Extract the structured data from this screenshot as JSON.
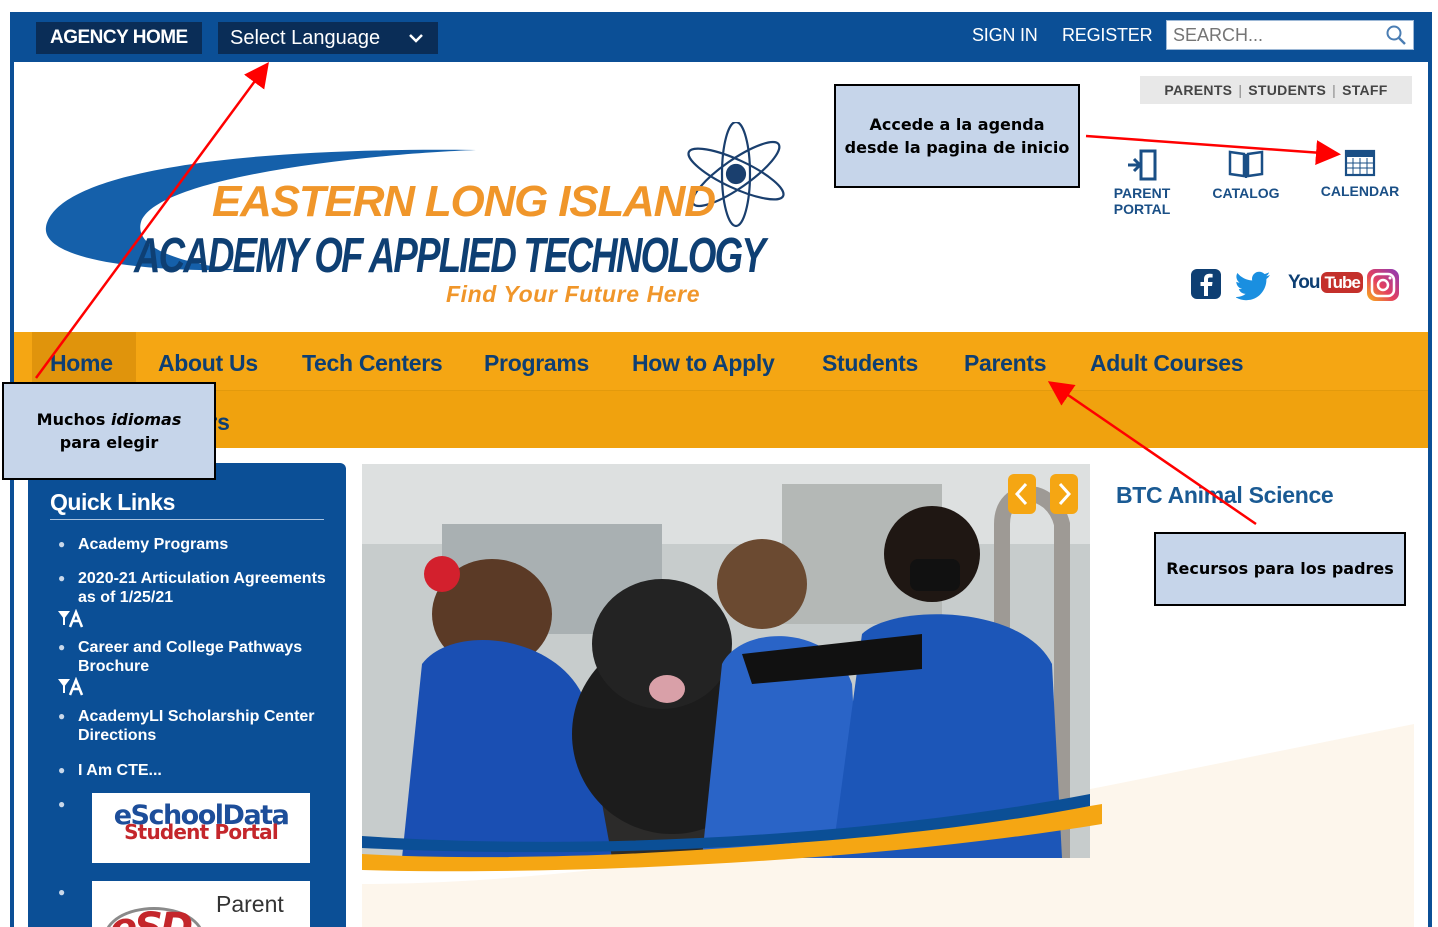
{
  "topbar": {
    "agency_home": "AGENCY HOME",
    "language": "Select Language",
    "sign_in": "SIGN IN",
    "register": "REGISTER",
    "search_placeholder": "SEARCH..."
  },
  "audience": {
    "parents": "PARENTS",
    "students": "STUDENTS",
    "staff": "STAFF",
    "sep": "|"
  },
  "logo": {
    "line1": "EASTERN LONG ISLAND",
    "line2": "ACADEMY OF APPLIED TECHNOLOGY",
    "tagline": "Find Your Future Here"
  },
  "quick_icons": {
    "parent_portal_1": "PARENT",
    "parent_portal_2": "PORTAL",
    "catalog": "CATALOG",
    "calendar": "CALENDAR"
  },
  "social": {
    "youtube_you": "You",
    "youtube_tube": "Tube"
  },
  "nav": {
    "items": [
      "Home",
      "About Us",
      "Tech Centers",
      "Programs",
      "How to Apply",
      "Students",
      "Parents",
      "Adult Courses"
    ],
    "row2": [
      "Careers"
    ]
  },
  "sidebar": {
    "title": "Quick Links",
    "items": [
      "Academy Programs",
      "2020-21 Articulation Agreements as of 1/25/21",
      "Career and College Pathways Brochure",
      "AcademyLI Scholarship Center Directions",
      "I Am CTE..."
    ],
    "eschool_line1": "eSchoolData",
    "eschool_line2": "Student Portal",
    "esd_logo": "eSD",
    "esd_text": "Parent"
  },
  "slideshow": {
    "title": "BTC Animal Science",
    "prev": "‹",
    "next": "›"
  },
  "callouts": {
    "language_1": "Muchos ",
    "language_em": "idiomas",
    "language_2": "para elegir",
    "calendar_1": "Accede a la agenda",
    "calendar_2": "desde la pagina de inicio",
    "parents": "Recursos para los padres"
  },
  "colors": {
    "blue": "#0b4f96",
    "dark_blue": "#0a2d57",
    "orange": "#f5a613",
    "nav_text": "#0e3f73",
    "callout_bg": "#c6d5ea",
    "arrow": "#ff0000"
  }
}
